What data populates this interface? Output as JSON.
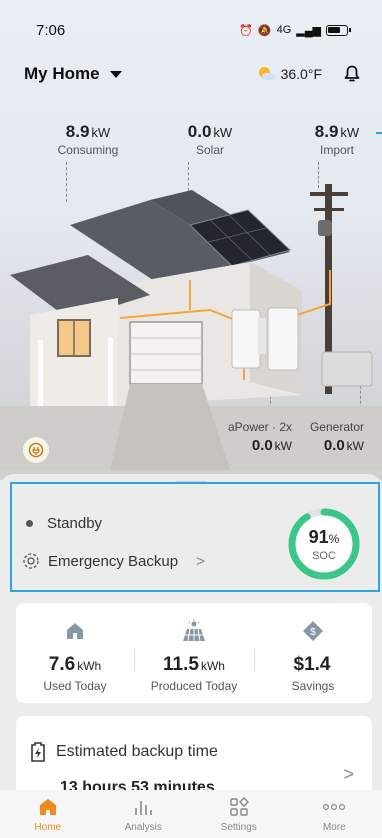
{
  "status_bar": {
    "time": "7:06",
    "network": "4G"
  },
  "header": {
    "title": "My Home",
    "temperature": "36.0°F"
  },
  "energy_flow": {
    "consuming": {
      "value": "8.9",
      "unit": "kW",
      "label": "Consuming"
    },
    "solar": {
      "value": "0.0",
      "unit": "kW",
      "label": "Solar"
    },
    "import": {
      "value": "8.9",
      "unit": "kW",
      "label": "Import"
    },
    "apower": {
      "label": "aPower · 2x",
      "value": "0.0",
      "unit": "kW"
    },
    "generator": {
      "label": "Generator",
      "value": "0.0",
      "unit": "kW"
    }
  },
  "status_card": {
    "mode": "Standby",
    "backup_mode": "Emergency Backup",
    "soc_value": "91",
    "soc_unit": "%",
    "soc_label": "SOC",
    "soc_fraction": 0.91
  },
  "stats": [
    {
      "value": "7.6",
      "unit": "kWh",
      "label": "Used Today",
      "icon": "house-icon"
    },
    {
      "value": "11.5",
      "unit": "kWh",
      "label": "Produced Today",
      "icon": "solar-panel-icon"
    },
    {
      "value": "$1.4",
      "unit": "",
      "label": "Savings",
      "icon": "savings-tag-icon"
    }
  ],
  "backup": {
    "title": "Estimated backup time",
    "time": "13 hours 53 minutes"
  },
  "tabs": [
    {
      "label": "Home",
      "icon": "home-icon"
    },
    {
      "label": "Analysis",
      "icon": "analysis-icon"
    },
    {
      "label": "Settings",
      "icon": "settings-icon"
    },
    {
      "label": "More",
      "icon": "more-icon"
    }
  ],
  "colors": {
    "accent": "#f08a1e",
    "soc_ring": "#3cc68a",
    "highlight_border": "#2aa6dc"
  }
}
